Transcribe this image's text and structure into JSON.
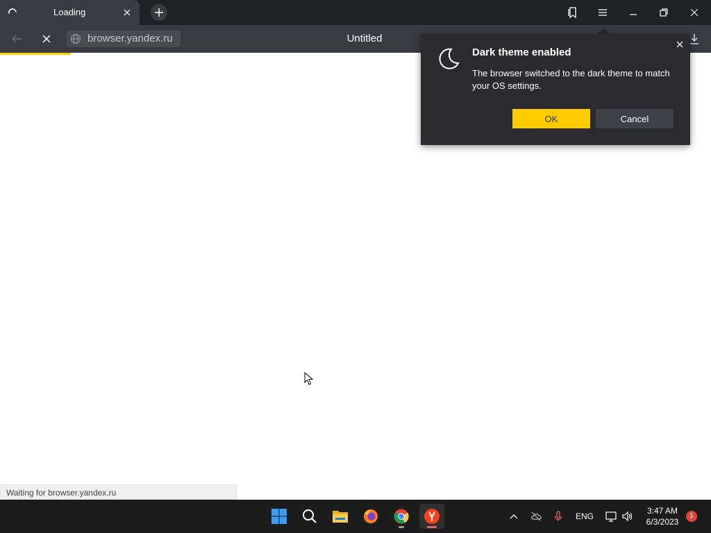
{
  "tab": {
    "title": "Loading",
    "spinner_icon": "loading-spinner-icon",
    "close_icon": "close-icon"
  },
  "new_tab_icon": "plus-icon",
  "window_controls": [
    "bookmarks-icon",
    "menu-icon",
    "minimize-icon",
    "restore-icon",
    "close-icon"
  ],
  "address_bar": {
    "url": "browser.yandex.ru",
    "page_title": "Untitled",
    "load_progress": 0.1
  },
  "popup": {
    "icon": "moon-icon",
    "title": "Dark theme enabled",
    "body": "The browser switched to the dark theme to match your OS settings.",
    "ok_label": "OK",
    "cancel_label": "Cancel"
  },
  "status_text": "Waiting for browser.yandex.ru",
  "taskbar": {
    "apps": [
      "windows-start-icon",
      "search-icon",
      "file-explorer-icon",
      "firefox-icon",
      "chrome-icon",
      "yandex-browser-icon"
    ],
    "language": "ENG",
    "time": "3:47 AM",
    "date": "6/3/2023",
    "notification_count": "1"
  },
  "colors": {
    "accent": "#ffcc00",
    "tab_bg": "#3a3b40",
    "popup_bg": "#2b2b2f",
    "taskbar_bg": "#1c1c1c"
  }
}
